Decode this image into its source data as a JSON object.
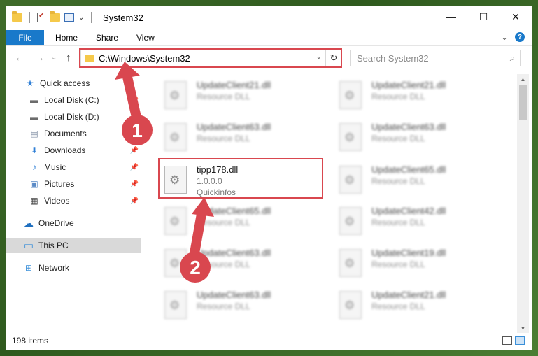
{
  "window": {
    "title": "System32",
    "controls": {
      "minimize": "—",
      "maximize": "☐",
      "close": "✕"
    }
  },
  "ribbon": {
    "tabs": [
      "File",
      "Home",
      "Share",
      "View"
    ],
    "expand_glyph": "⌄",
    "help_glyph": "?"
  },
  "nav": {
    "back_glyph": "←",
    "forward_glyph": "→",
    "recent_glyph": "⌄",
    "up_glyph": "↑",
    "address": "C:\\Windows\\System32",
    "address_drop_glyph": "⌄",
    "refresh_glyph": "↻",
    "search_placeholder": "Search System32",
    "search_glyph": "⌕"
  },
  "sidebar": {
    "items": [
      {
        "label": "Quick access",
        "icon": "star-icon",
        "glyph": "★",
        "color": "#2f7fd6"
      },
      {
        "label": "Local Disk (C:)",
        "icon": "drive-icon",
        "glyph": "▬",
        "color": "#6b6b6b",
        "pinned": true
      },
      {
        "label": "Local Disk (D:)",
        "icon": "drive-icon",
        "glyph": "▬",
        "color": "#6b6b6b",
        "pinned": true
      },
      {
        "label": "Documents",
        "icon": "documents-icon",
        "glyph": "▤",
        "color": "#7b8aa0",
        "pinned": true
      },
      {
        "label": "Downloads",
        "icon": "downloads-icon",
        "glyph": "⬇",
        "color": "#2f7fd6",
        "pinned": true
      },
      {
        "label": "Music",
        "icon": "music-icon",
        "glyph": "♪",
        "color": "#2f7fd6",
        "pinned": true
      },
      {
        "label": "Pictures",
        "icon": "pictures-icon",
        "glyph": "▣",
        "color": "#5a8ac6",
        "pinned": true
      },
      {
        "label": "Videos",
        "icon": "videos-icon",
        "glyph": "▦",
        "color": "#444444",
        "pinned": true
      },
      {
        "label": "OneDrive",
        "icon": "cloud-icon",
        "glyph": "☁",
        "color": "#1f6fbf"
      },
      {
        "label": "This PC",
        "icon": "computer-icon",
        "glyph": "▭",
        "color": "#3a8fd9"
      },
      {
        "label": "Network",
        "icon": "network-icon",
        "glyph": "⊞",
        "color": "#3a8fd9"
      }
    ],
    "pin_glyph": "📌"
  },
  "files": [
    {
      "name": "UpdateClient21.dll",
      "type": "Resource DLL"
    },
    {
      "name": "UpdateClient21.dll",
      "type": "Resource DLL"
    },
    {
      "name": "UpdateClient63.dll",
      "type": "Resource DLL"
    },
    {
      "name": "UpdateClient63.dll",
      "type": "Resource DLL"
    },
    {
      "name": "tipp178.dll",
      "version": "1.0.0.0",
      "company": "Quickinfos"
    },
    {
      "name": "UpdateClient65.dll",
      "type": "Resource DLL"
    },
    {
      "name": "UpdateClient65.dll",
      "type": "Resource DLL"
    },
    {
      "name": "UpdateClient42.dll",
      "type": "Resource DLL"
    },
    {
      "name": "UpdateClient63.dll",
      "type": "Resource DLL"
    },
    {
      "name": "UpdateClient19.dll",
      "type": "Resource DLL"
    },
    {
      "name": "UpdateClient63.dll",
      "type": "Resource DLL"
    },
    {
      "name": "UpdateClient21.dll",
      "type": "Resource DLL"
    }
  ],
  "status": {
    "count": "198 items"
  },
  "annotations": {
    "badges": [
      "1",
      "2"
    ],
    "color": "#d9474f"
  }
}
